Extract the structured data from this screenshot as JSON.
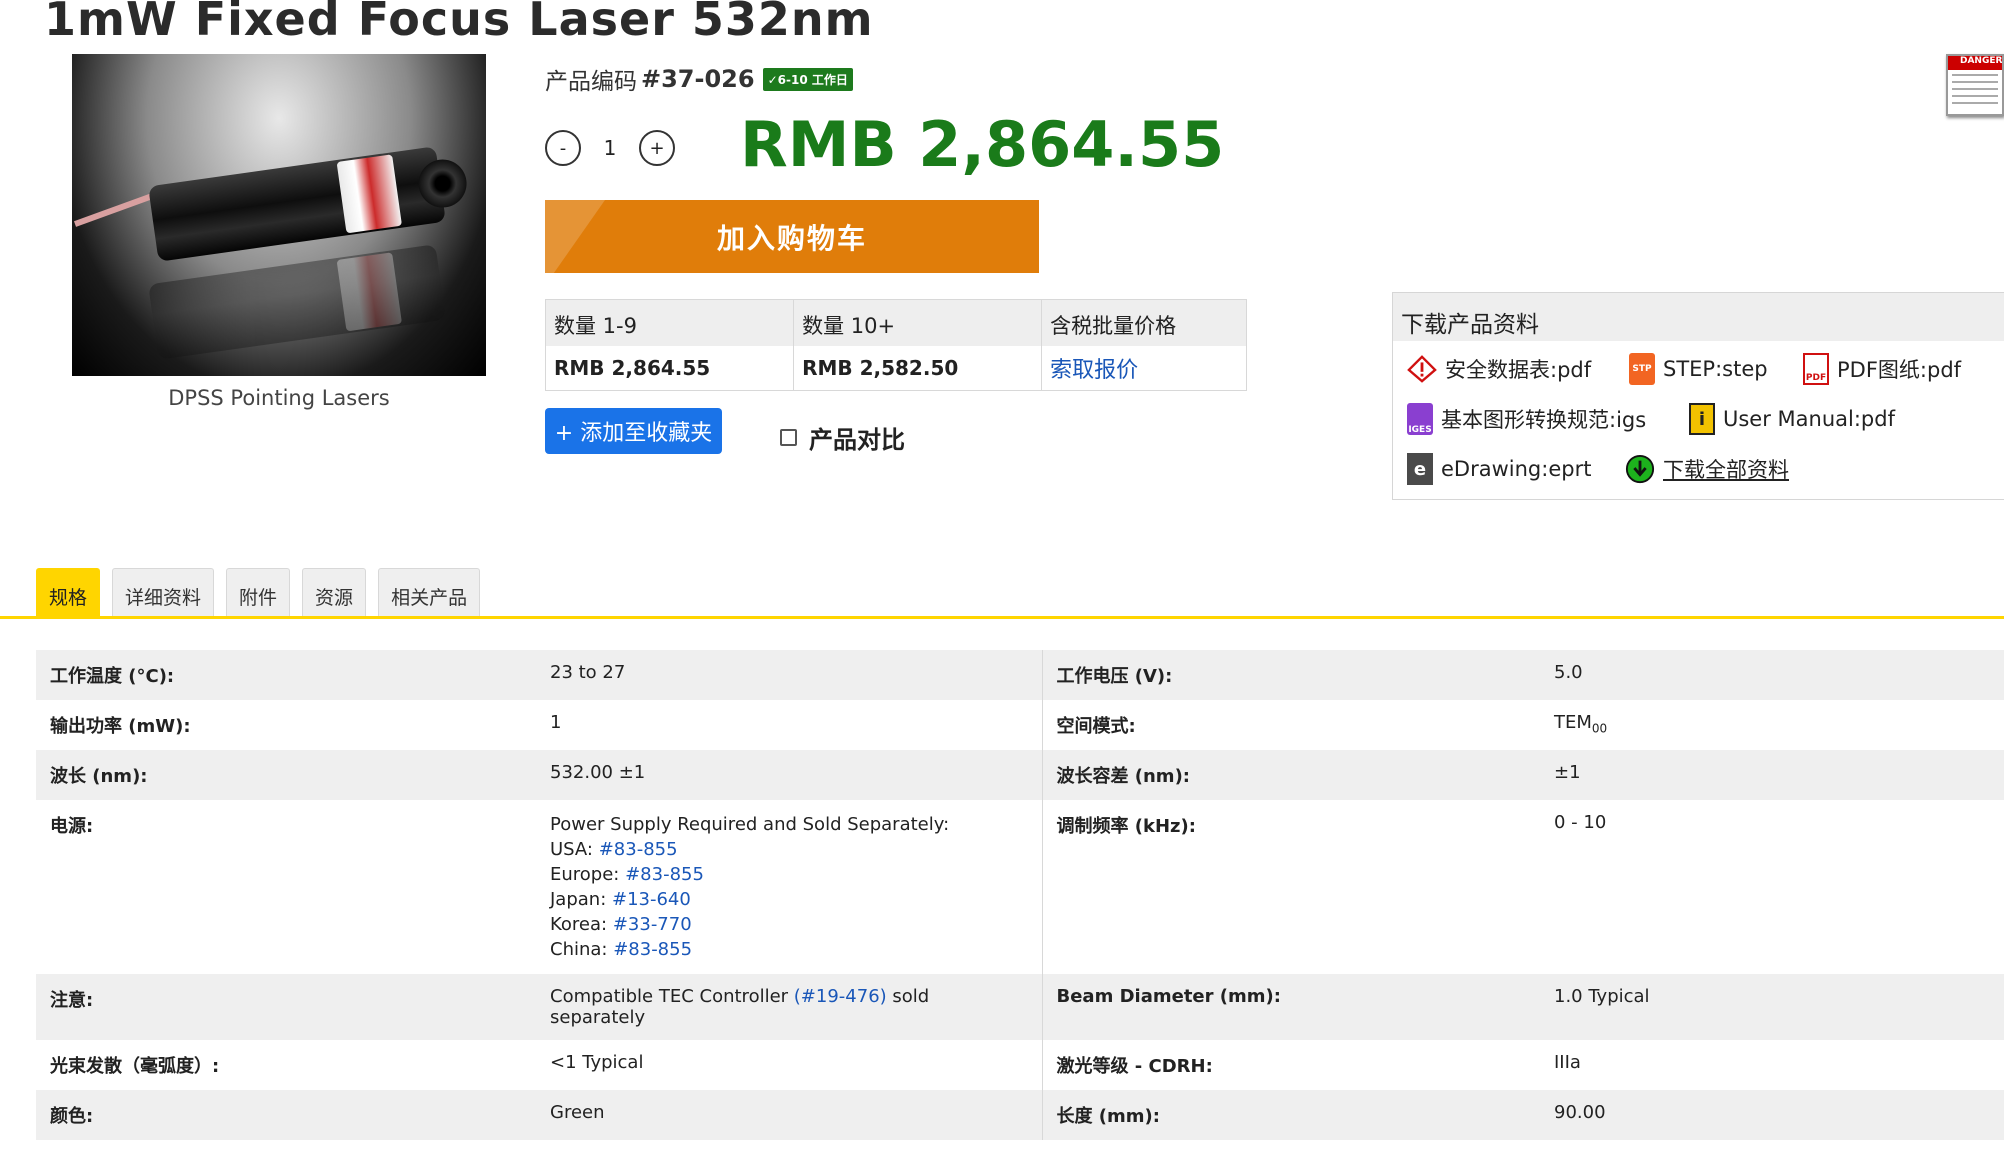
{
  "title": "1mW Fixed Focus Laser 532nm",
  "image": {
    "caption": "DPSS Pointing Lasers"
  },
  "product_code": {
    "label": "产品编码",
    "code": "#37-026",
    "ship_badge": "✓6-10 工作日"
  },
  "quantity": {
    "minus": "-",
    "value": "1",
    "plus": "+"
  },
  "price": "RMB 2,864.55",
  "cart_button": "加入购物车",
  "price_table": {
    "headers": [
      "数量 1-9",
      "数量 10+",
      "含税批量价格"
    ],
    "values": [
      "RMB 2,864.55",
      "RMB 2,582.50",
      "索取报价"
    ]
  },
  "favorite_button": "+ 添加至收藏夹",
  "compare_label": "产品对比",
  "downloads": {
    "title": "下载产品资料",
    "items": [
      {
        "label": "安全数据表:pdf",
        "icon": "warning-icon"
      },
      {
        "label": "STEP:step",
        "icon": "step-file-icon",
        "tag": "STP"
      },
      {
        "label": "PDF图纸:pdf",
        "icon": "pdf-file-icon",
        "tag": "PDF"
      },
      {
        "label": "基本图形转换规范:igs",
        "icon": "iges-file-icon",
        "tag": "IGES"
      },
      {
        "label": "User Manual:pdf",
        "icon": "manual-icon"
      },
      {
        "label": "eDrawing:eprt",
        "icon": "edrawing-icon"
      },
      {
        "label": "下载全部资料",
        "icon": "download-all-icon"
      }
    ]
  },
  "tabs": [
    "规格",
    "详细资料",
    "附件",
    "资源",
    "相关产品"
  ],
  "specs": {
    "rows": [
      {
        "k1": "工作温度 (°C):",
        "v1": "23 to 27",
        "k2": "工作电压 (V):",
        "v2": "5.0"
      },
      {
        "k1": "输出功率 (mW):",
        "v1": "1",
        "k2": "空间模式:",
        "v2": "TEM",
        "v2_sub": "00"
      },
      {
        "k1": "波长 (nm):",
        "v1": "532.00 ±1",
        "k2": "波长容差 (nm):",
        "v2": "±1"
      },
      {
        "k1": "电源:",
        "k2": "调制频率 (kHz):",
        "v2": "0 - 10"
      },
      {
        "k1": "注意:",
        "k2": "Beam Diameter (mm):",
        "v2": "1.0 Typical"
      },
      {
        "k1": "光束发散（毫弧度）:",
        "v1": "<1 Typical",
        "k2": "激光等级 - CDRH:",
        "v2": "IIIa"
      },
      {
        "k1": "颜色:",
        "v1": "Green",
        "k2": "长度 (mm):",
        "v2": "90.00"
      }
    ],
    "power_supply": {
      "intro": "Power Supply Required and Sold Separately:",
      "regions": [
        {
          "region": "USA: ",
          "code": "#83-855"
        },
        {
          "region": "Europe: ",
          "code": "#83-855"
        },
        {
          "region": "Japan: ",
          "code": "#13-640"
        },
        {
          "region": "Korea: ",
          "code": "#33-770"
        },
        {
          "region": "China: ",
          "code": "#83-855"
        }
      ]
    },
    "note": {
      "pre": "Compatible TEC Controller ",
      "link": "(#19-476)",
      "post": " sold separately"
    }
  },
  "colors": {
    "price": "#1a7b1a",
    "cart": "#e07d0a",
    "tab_active": "#ffd500",
    "link": "#1a57b8",
    "fav": "#1a73e8"
  }
}
